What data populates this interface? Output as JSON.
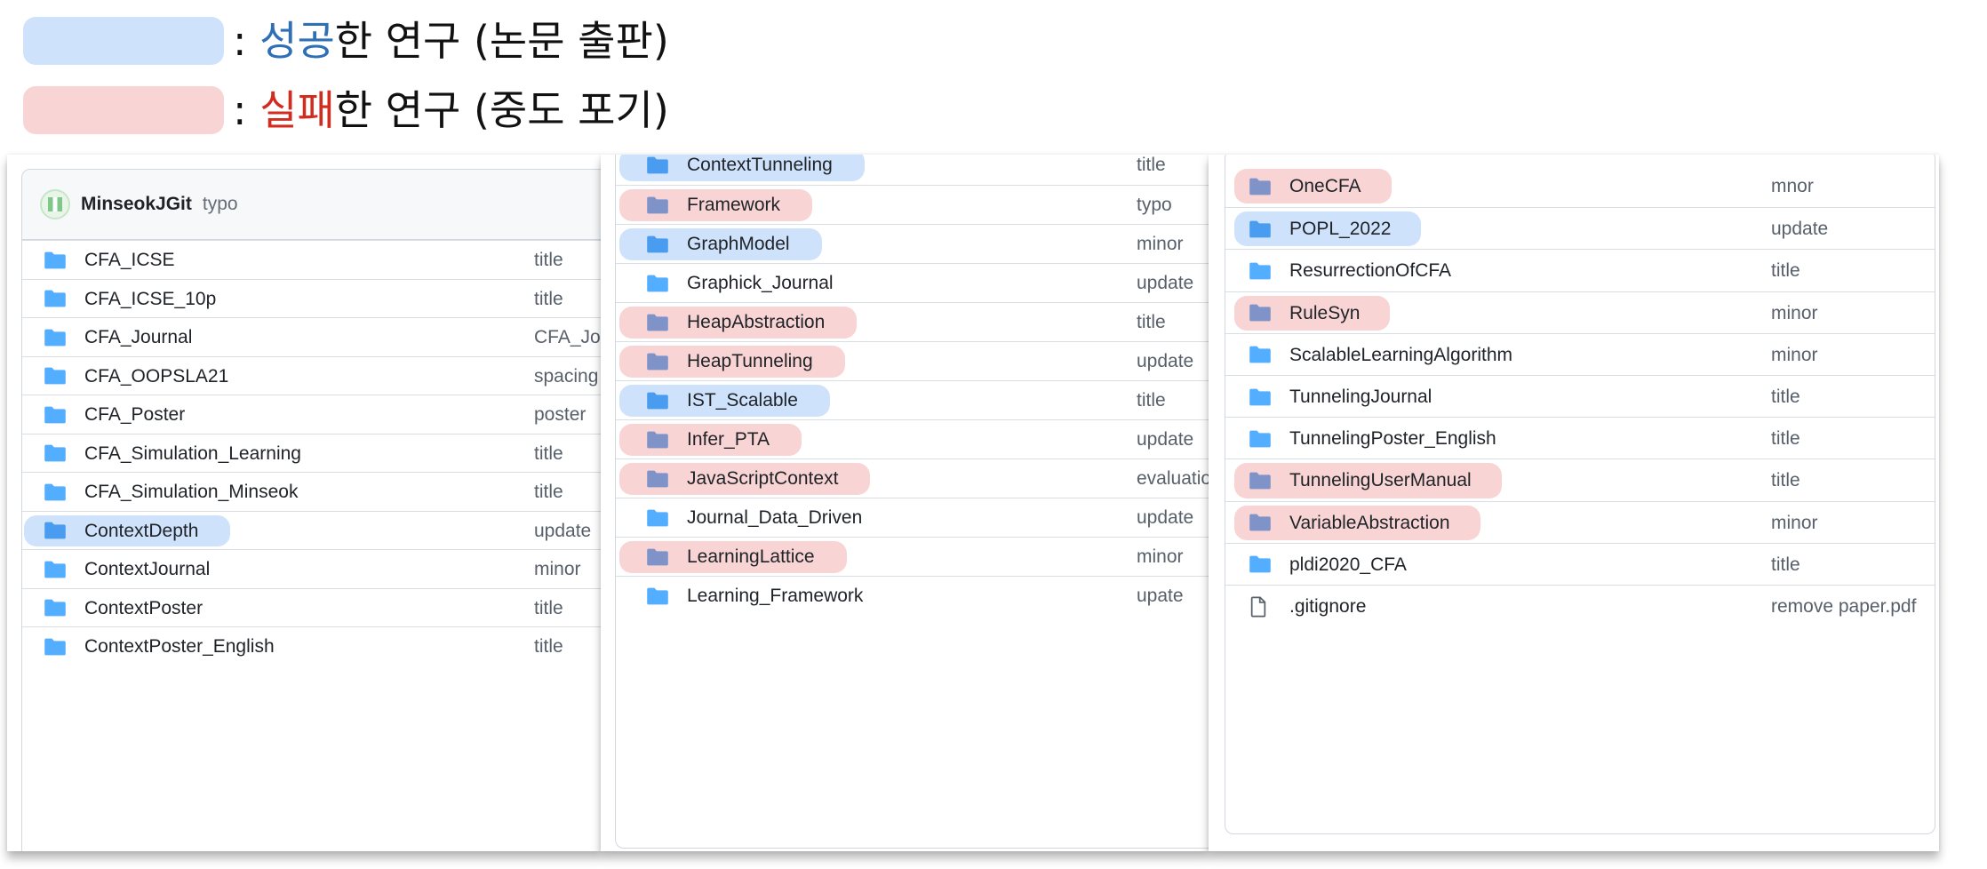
{
  "legend": {
    "success": {
      "color": "#cfe2fb",
      "prefix": ": ",
      "keyword": "성공",
      "suffix": "한 연구 (논문 출판)",
      "keyword_color": "#2f6fb6"
    },
    "fail": {
      "color": "#f8d4d4",
      "prefix": ": ",
      "keyword": "실패",
      "suffix": "한 연구 (중도 포기)",
      "keyword_color": "#d12c1f"
    }
  },
  "repo_header": {
    "owner": "MinseokJGit",
    "latest_commit": "typo",
    "avatar_icon": "identicon-avatar"
  },
  "panels": [
    {
      "items": [
        {
          "name": "CFA_ICSE",
          "commit": "title",
          "status": "none",
          "icon": "folder-icon"
        },
        {
          "name": "CFA_ICSE_10p",
          "commit": "title",
          "status": "none",
          "icon": "folder-icon"
        },
        {
          "name": "CFA_Journal",
          "commit": "CFA_Jou",
          "status": "none",
          "icon": "folder-icon"
        },
        {
          "name": "CFA_OOPSLA21",
          "commit": "spacing",
          "status": "none",
          "icon": "folder-icon"
        },
        {
          "name": "CFA_Poster",
          "commit": "poster",
          "status": "none",
          "icon": "folder-icon"
        },
        {
          "name": "CFA_Simulation_Learning",
          "commit": "title",
          "status": "none",
          "icon": "folder-icon"
        },
        {
          "name": "CFA_Simulation_Minseok",
          "commit": "title",
          "status": "none",
          "icon": "folder-icon"
        },
        {
          "name": "ContextDepth",
          "commit": "update",
          "status": "success",
          "icon": "folder-icon"
        },
        {
          "name": "ContextJournal",
          "commit": "minor",
          "status": "none",
          "icon": "folder-icon"
        },
        {
          "name": "ContextPoster",
          "commit": "title",
          "status": "none",
          "icon": "folder-icon"
        },
        {
          "name": "ContextPoster_English",
          "commit": "title",
          "status": "none",
          "icon": "folder-icon"
        }
      ]
    },
    {
      "items": [
        {
          "name": "ContextTunneling",
          "commit": "title",
          "status": "success",
          "icon": "folder-icon"
        },
        {
          "name": "Framework",
          "commit": "typo",
          "status": "fail",
          "icon": "folder-icon"
        },
        {
          "name": "GraphModel",
          "commit": "minor",
          "status": "success",
          "icon": "folder-icon"
        },
        {
          "name": "Graphick_Journal",
          "commit": "update",
          "status": "none",
          "icon": "folder-icon"
        },
        {
          "name": "HeapAbstraction",
          "commit": "title",
          "status": "fail",
          "icon": "folder-icon"
        },
        {
          "name": "HeapTunneling",
          "commit": "update",
          "status": "fail",
          "icon": "folder-icon"
        },
        {
          "name": "IST_Scalable",
          "commit": "title",
          "status": "success",
          "icon": "folder-icon"
        },
        {
          "name": "Infer_PTA",
          "commit": "update",
          "status": "fail",
          "icon": "folder-icon"
        },
        {
          "name": "JavaScriptContext",
          "commit": "evaluatio",
          "status": "fail",
          "icon": "folder-icon"
        },
        {
          "name": "Journal_Data_Driven",
          "commit": "update",
          "status": "none",
          "icon": "folder-icon"
        },
        {
          "name": "LearningLattice",
          "commit": "minor",
          "status": "fail",
          "icon": "folder-icon"
        },
        {
          "name": "Learning_Framework",
          "commit": "upate",
          "status": "none",
          "icon": "folder-icon"
        }
      ]
    },
    {
      "items": [
        {
          "name": "OneCFA",
          "commit": "mnor",
          "status": "fail",
          "icon": "folder-icon"
        },
        {
          "name": "POPL_2022",
          "commit": "update",
          "status": "success",
          "icon": "folder-icon"
        },
        {
          "name": "ResurrectionOfCFA",
          "commit": "title",
          "status": "none",
          "icon": "folder-icon"
        },
        {
          "name": "RuleSyn",
          "commit": "minor",
          "status": "fail",
          "icon": "folder-icon"
        },
        {
          "name": "ScalableLearningAlgorithm",
          "commit": "minor",
          "status": "none",
          "icon": "folder-icon"
        },
        {
          "name": "TunnelingJournal",
          "commit": "title",
          "status": "none",
          "icon": "folder-icon"
        },
        {
          "name": "TunnelingPoster_English",
          "commit": "title",
          "status": "none",
          "icon": "folder-icon"
        },
        {
          "name": "TunnelingUserManual",
          "commit": "title",
          "status": "fail",
          "icon": "folder-icon"
        },
        {
          "name": "VariableAbstraction",
          "commit": "minor",
          "status": "fail",
          "icon": "folder-icon"
        },
        {
          "name": "pldi2020_CFA",
          "commit": "title",
          "status": "none",
          "icon": "folder-icon"
        },
        {
          "name": ".gitignore",
          "commit": "remove paper.pdf",
          "status": "none",
          "icon": "file-icon"
        }
      ]
    }
  ],
  "colors": {
    "folder": "#54aeff",
    "folder_on_fail": "#7f93c9",
    "folder_on_success": "#4a9cf0",
    "file": "#57606a"
  }
}
